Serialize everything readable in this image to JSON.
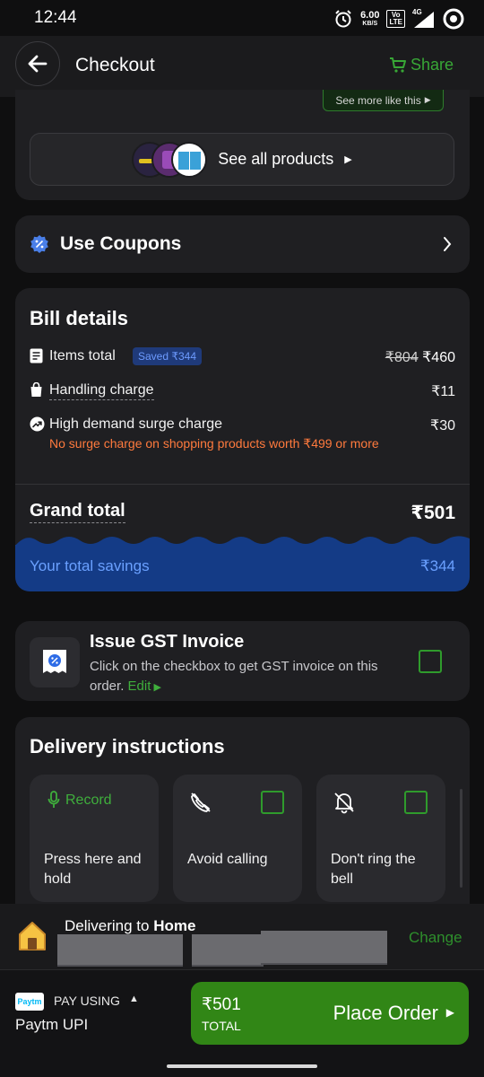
{
  "status_bar": {
    "time": "12:44",
    "net_speed_value": "6.00",
    "net_speed_unit": "KB/S",
    "volte_top": "Vo",
    "volte_bottom": "LTE",
    "network": "4G"
  },
  "header": {
    "title": "Checkout",
    "share_label": "Share"
  },
  "products": {
    "see_more_label": "See more like this",
    "see_all_label": "See all products"
  },
  "coupons": {
    "label": "Use Coupons"
  },
  "bill": {
    "title": "Bill details",
    "items_total_label": "Items total",
    "saved_badge": "Saved ₹344",
    "items_total_original": "₹804",
    "items_total_value": "₹460",
    "handling_label": "Handling charge",
    "handling_value": "₹11",
    "surge_label": "High demand surge charge",
    "surge_value": "₹30",
    "surge_note": "No surge charge on shopping products worth ₹499 or more",
    "grand_total_label": "Grand total",
    "grand_total_value": "₹501",
    "savings_label": "Your total savings",
    "savings_value": "₹344"
  },
  "gst": {
    "title": "Issue GST Invoice",
    "description": "Click on the checkbox to get GST invoice on this order.",
    "edit_label": "Edit"
  },
  "delivery_instructions": {
    "title": "Delivery instructions",
    "record_label": "Record",
    "record_text": "Press here and hold",
    "avoid_calling": "Avoid calling",
    "dont_ring": "Don't ring the bell"
  },
  "delivery_bar": {
    "prefix": "Delivering to ",
    "location": "Home",
    "change_label": "Change"
  },
  "footer": {
    "pay_using_label": "PAY USING",
    "paytm_logo_text": "Paytm",
    "payment_method": "Paytm UPI",
    "total_value": "₹501",
    "total_label": "TOTAL",
    "place_order_label": "Place Order"
  },
  "colors": {
    "accent_green": "#318616",
    "coupon_blue": "#4a7fe8",
    "surge_orange": "#ff7a3d",
    "savings_band": "#143b86"
  }
}
